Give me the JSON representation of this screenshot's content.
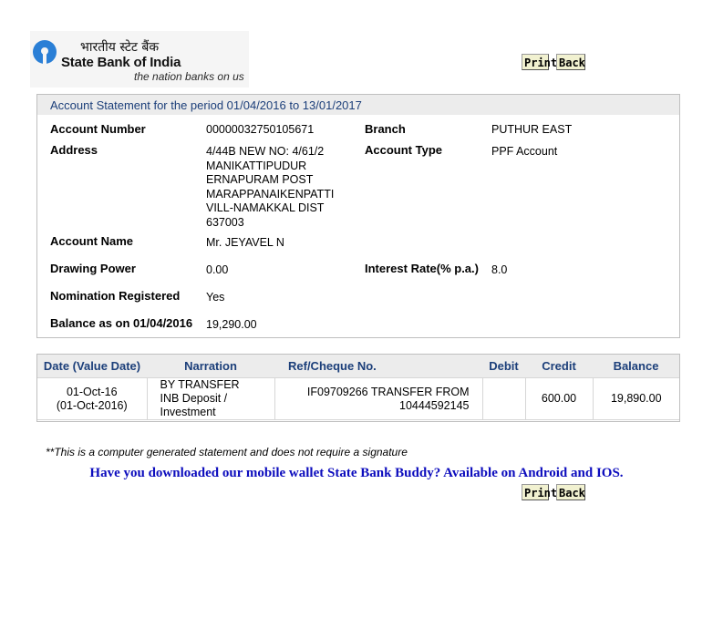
{
  "logo": {
    "hindi": "भारतीय स्टेट बैंक",
    "name": "State Bank of India",
    "tagline": "the nation banks on us",
    "brand_color": "#2a7fd6"
  },
  "buttons": {
    "print": "Print",
    "back": "Back"
  },
  "statement": {
    "header": "Account Statement for the period 01/04/2016 to 13/01/2017",
    "account_number_label": "Account Number",
    "account_number": "00000032750105671",
    "branch_label": "Branch",
    "branch": "PUTHUR EAST",
    "address_label": "Address",
    "address_lines": [
      "4/44B NEW NO: 4/61/2",
      "MANIKATTIPUDUR",
      "ERNAPURAM POST",
      "MARAPPANAIKENPATTI",
      "VILL-NAMAKKAL DIST",
      "637003"
    ],
    "account_type_label": "Account Type",
    "account_type": "PPF Account",
    "account_name_label": "Account Name",
    "account_name": "Mr. JEYAVEL N",
    "drawing_power_label": "Drawing Power",
    "drawing_power": "0.00",
    "interest_rate_label": "Interest Rate(% p.a.)",
    "interest_rate": "8.0",
    "nomination_label": "Nomination Registered",
    "nomination": "Yes",
    "balance_label": "Balance as on 01/04/2016",
    "balance": "19,290.00"
  },
  "transactions": {
    "headers": [
      "Date (Value Date)",
      "Narration",
      "Ref/Cheque No.",
      "Debit",
      "Credit",
      "Balance"
    ],
    "rows": [
      {
        "date": "01-Oct-16",
        "value_date": "(01-Oct-2016)",
        "narration_lines": [
          "BY TRANSFER",
          "INB Deposit /",
          "Investment"
        ],
        "ref_lines": [
          "IF09709266 TRANSFER FROM",
          "10444592145"
        ],
        "debit": "",
        "credit": "600.00",
        "balance": "19,890.00"
      }
    ]
  },
  "footer": {
    "note": "**This is a computer generated statement and does not require a signature",
    "promo": "Have you downloaded our mobile wallet State Bank Buddy? Available on Android and IOS.",
    "promo_color": "#0c0cbd"
  }
}
